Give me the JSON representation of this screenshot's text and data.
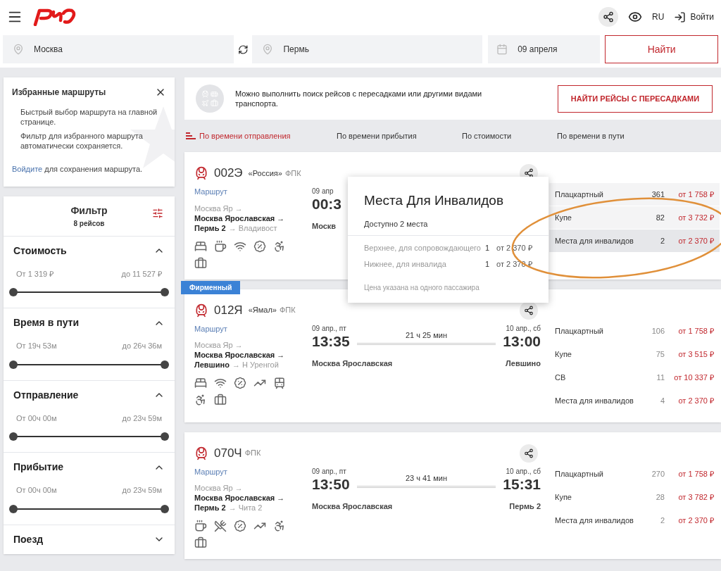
{
  "header": {
    "language": "RU",
    "login": "Войти"
  },
  "search": {
    "from": "Москва",
    "to": "Пермь",
    "date": "09 апреля",
    "submit": "Найти"
  },
  "favorites": {
    "title": "Избранные маршруты",
    "lines": [
      "Быстрый выбор маршрута на главной странице.",
      "Фильтр для избранного маршрута автоматически сохраняется."
    ],
    "login_link": "Войдите",
    "login_text": "для сохранения маршрута."
  },
  "filter": {
    "title": "Фильтр",
    "count": "8 рейсов",
    "sections": [
      {
        "title": "Стоимость",
        "expanded": true,
        "from": "От 1 319 ₽",
        "to": "до 11 527 ₽",
        "level": 1
      },
      {
        "title": "Время в пути",
        "expanded": true,
        "from": "От 19ч 53м",
        "to": "до 26ч 36м",
        "level": 1
      },
      {
        "title": "Отправление",
        "expanded": true,
        "from": "От 00ч 00м",
        "to": "до 23ч 59м",
        "level": 1
      },
      {
        "title": "Прибытие",
        "expanded": true,
        "from": "От 00ч 00м",
        "to": "до 23ч 59м",
        "level": 1
      },
      {
        "title": "Поезд",
        "expanded": false
      }
    ]
  },
  "transfer_banner": {
    "text": "Можно выполнить поиск рейсов с пересадками или другими видами транспорта.",
    "button": "НАЙТИ РЕЙСЫ С ПЕРЕСАДКАМИ"
  },
  "sort_tabs": [
    {
      "label": "По времени отправления",
      "selected": true
    },
    {
      "label": "По времени прибытия",
      "selected": false
    },
    {
      "label": "По стоимости",
      "selected": false
    },
    {
      "label": "По времени в пути",
      "selected": false
    }
  ],
  "trains": [
    {
      "number": "002Э",
      "name": "«Россия»",
      "carrier": "ФПК",
      "open": true,
      "route_link": "Маршрут",
      "route_start": "Москва Яр →",
      "route_main": "Москва Ярославская →",
      "route_end": "Пермь 2",
      "route_final": "→ Владивост",
      "departure": {
        "date": "09 апр",
        "time": "00:3",
        "station": "Москв"
      },
      "amenities": [
        {
          "kind": "bed"
        },
        {
          "kind": "coffee"
        },
        {
          "kind": "wifi"
        },
        {
          "kind": "discount"
        },
        {
          "kind": "accessible"
        },
        {
          "kind": "luggage"
        }
      ],
      "classes": [
        {
          "name": "Плацкартный",
          "seats": "361",
          "price": "от 1 758 ₽",
          "selected": false
        },
        {
          "name": "Купе",
          "seats": "82",
          "price": "от 3 732 ₽",
          "selected": false
        },
        {
          "name": "Места для инвалидов",
          "seats": "2",
          "price": "от 2 370 ₽",
          "selected": true
        }
      ],
      "popup": {
        "title": "Места Для Инвалидов",
        "subtitle": "Доступно 2 места",
        "rows": [
          {
            "label": "Верхнее, для сопровождающего",
            "count": "1",
            "price": "от 2 370 ₽"
          },
          {
            "label": "Нижнее, для инвалида",
            "count": "1",
            "price": "от 2 370 ₽"
          }
        ],
        "note": "Цена указана на одного пассажира"
      }
    },
    {
      "badge": "Фирменный",
      "number": "012Я",
      "name": "«Ямал»",
      "carrier": "ФПК",
      "open": false,
      "route_link": "Маршрут",
      "route_start": "Москва Яр →",
      "route_main": "Москва Ярославская →",
      "route_end": "Левшино",
      "route_final": "→ Н Уренгой",
      "departure": {
        "date": "09 апр., пт",
        "time": "13:35",
        "station": "Москва Ярославская"
      },
      "duration": "21 ч 25 мин",
      "arrival": {
        "date": "10 апр., сб",
        "time": "13:00",
        "station": "Левшино"
      },
      "amenities": [
        {
          "kind": "bed"
        },
        {
          "kind": "wifi"
        },
        {
          "kind": "discount"
        },
        {
          "kind": "chart"
        },
        {
          "kind": "train"
        },
        {
          "kind": "accessible"
        },
        {
          "kind": "luggage"
        }
      ],
      "classes": [
        {
          "name": "Плацкартный",
          "seats": "106",
          "price": "от 1 758 ₽",
          "selected": false
        },
        {
          "name": "Купе",
          "seats": "75",
          "price": "от 3 515 ₽",
          "selected": false
        },
        {
          "name": "СВ",
          "seats": "11",
          "price": "от 10 337 ₽",
          "selected": false
        },
        {
          "name": "Места для инвалидов",
          "seats": "4",
          "price": "от 2 370 ₽",
          "selected": false
        }
      ]
    },
    {
      "number": "070Ч",
      "carrier": "ФПК",
      "open": false,
      "route_link": "Маршрут",
      "route_start": "Москва Яр →",
      "route_main": "Москва Ярославская →",
      "route_end": "Пермь 2",
      "route_final": "→ Чита 2",
      "departure": {
        "date": "09 апр., пт",
        "time": "13:50",
        "station": "Москва Ярославская"
      },
      "duration": "23 ч 41 мин",
      "arrival": {
        "date": "10 апр., сб",
        "time": "15:31",
        "station": "Пермь 2"
      },
      "amenities": [
        {
          "kind": "coffee"
        },
        {
          "kind": "food"
        },
        {
          "kind": "discount"
        },
        {
          "kind": "chart"
        },
        {
          "kind": "accessible"
        },
        {
          "kind": "luggage"
        }
      ],
      "classes": [
        {
          "name": "Плацкартный",
          "seats": "270",
          "price": "от 1 758 ₽",
          "selected": false
        },
        {
          "name": "Купе",
          "seats": "28",
          "price": "от 3 782 ₽",
          "selected": false
        },
        {
          "name": "Места для инвалидов",
          "seats": "2",
          "price": "от 2 370 ₽",
          "selected": false
        }
      ]
    }
  ]
}
